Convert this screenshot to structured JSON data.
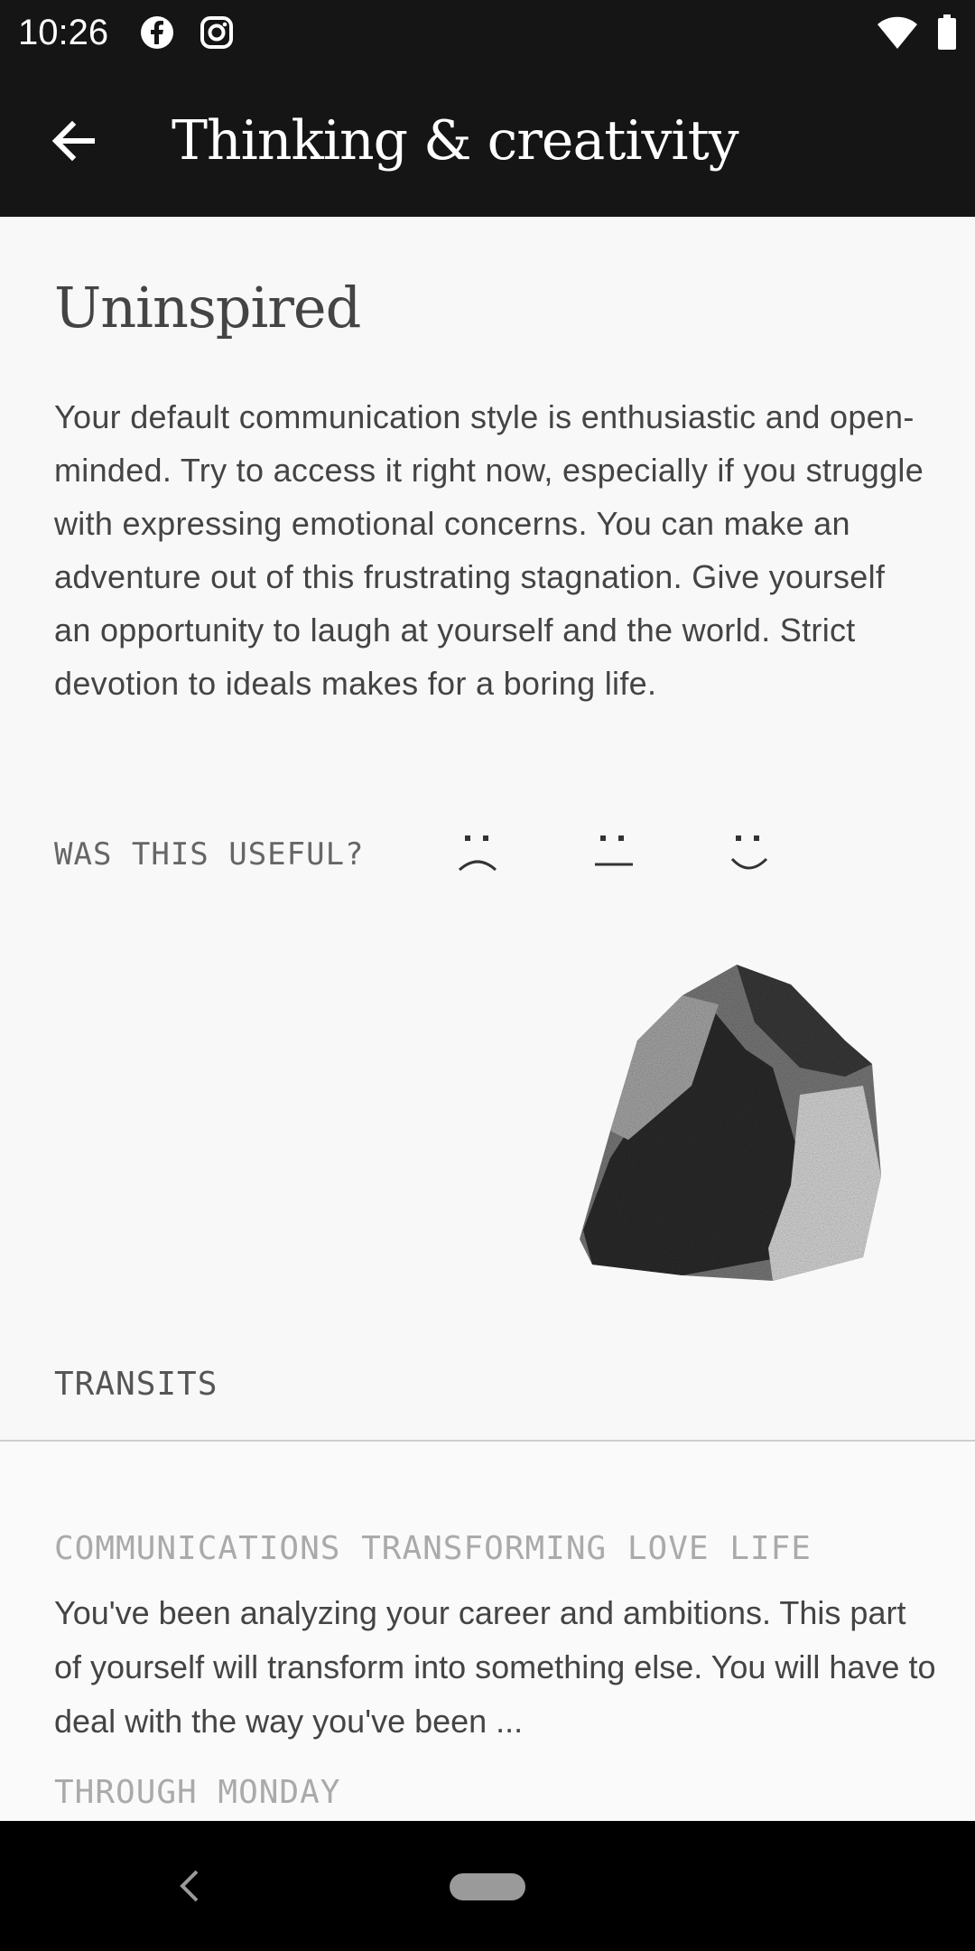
{
  "status_bar": {
    "time": "10:26",
    "icons": [
      "facebook-icon",
      "instagram-icon",
      "wifi-icon",
      "battery-icon"
    ]
  },
  "app_bar": {
    "title": "Thinking & creativity",
    "back_icon": "arrow-left-icon"
  },
  "main": {
    "title": "Uninspired",
    "body": "Your default communication style is enthusiastic and open-minded. Try to access it right now, especially if you struggle with expressing emotional concerns. You can make an adventure out of this frustrating stagnation. Give yourself an opportunity to laugh at yourself and the world. Strict devotion to ideals makes for a boring life.",
    "feedback_label": "WAS THIS USEFUL?",
    "feedback_options": [
      "sad-face-icon",
      "neutral-face-icon",
      "happy-face-icon"
    ]
  },
  "transits": {
    "section_label": "TRANSITS",
    "items": [
      {
        "title": "COMMUNICATIONS TRANSFORMING LOVE LIFE",
        "text": "You've been analyzing your career and ambitions. This part of yourself will transform into something else. You will have to deal with the way you've been ...",
        "date": "THROUGH MONDAY"
      }
    ]
  },
  "colors": {
    "header_bg": "#151515",
    "page_bg": "#f8f8f8",
    "text": "#444444",
    "muted_text": "#aaaaaa"
  }
}
